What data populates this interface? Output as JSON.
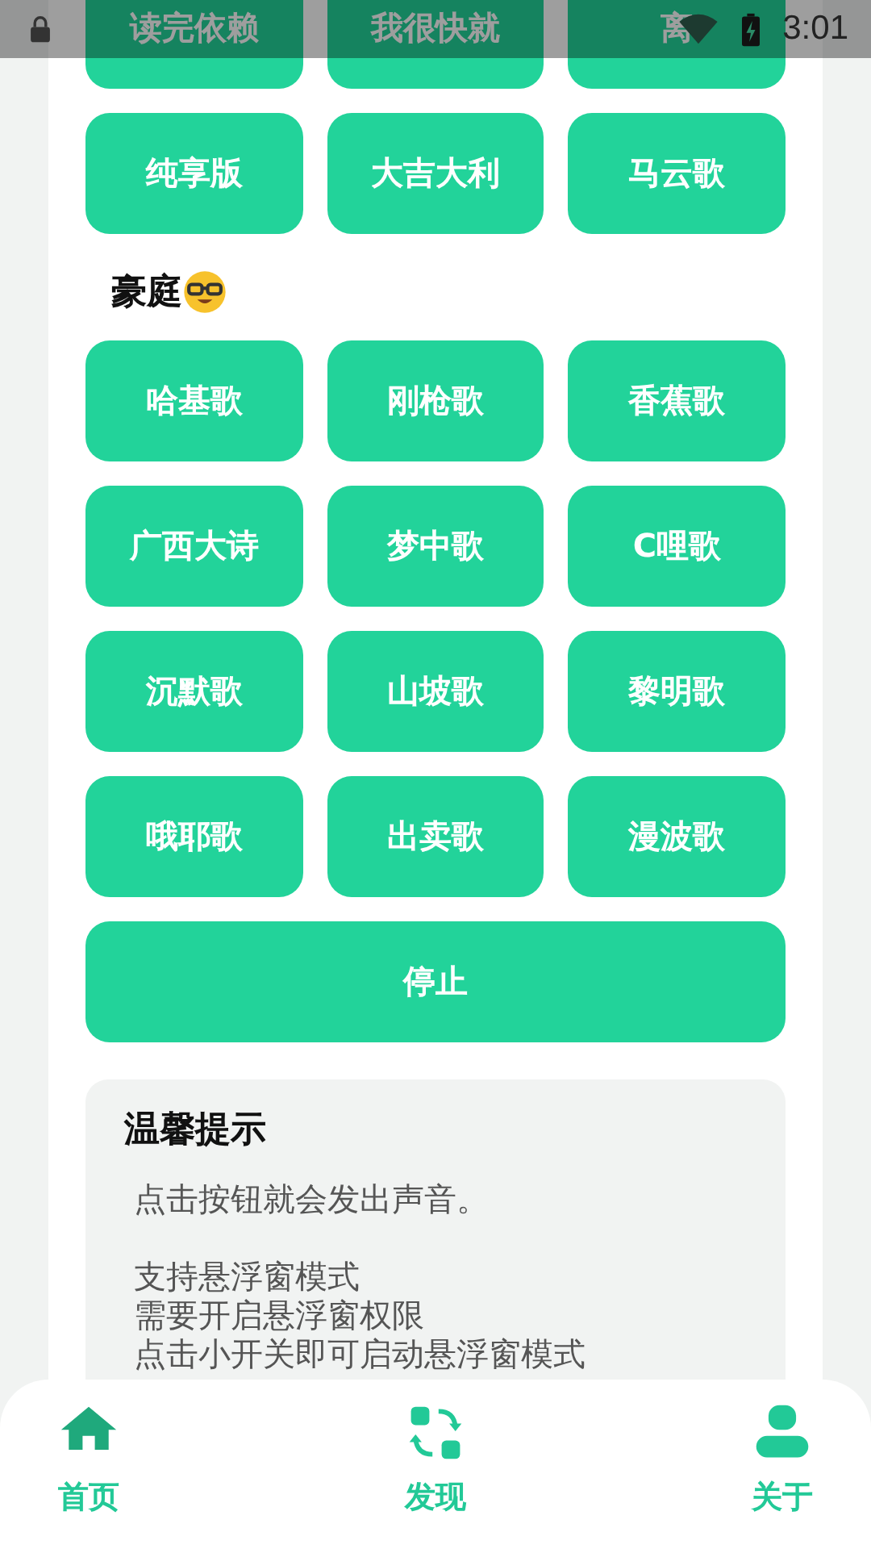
{
  "status_bar": {
    "time": "3:01"
  },
  "sections": [
    {
      "buttons": [
        "读完依赖",
        "我很快就",
        "离",
        "纯享版",
        "大吉大利",
        "马云歌"
      ]
    },
    {
      "title": "豪庭",
      "buttons": [
        "哈基歌",
        "刚枪歌",
        "香蕉歌",
        "广西大诗",
        "梦中歌",
        "C哩歌",
        "沉默歌",
        "山坡歌",
        "黎明歌",
        "哦耶歌",
        "出卖歌",
        "漫波歌"
      ],
      "wide_button": "停止"
    }
  ],
  "tips": {
    "title": "温馨提示",
    "paragraphs": [
      [
        "点击按钮就会发出声音。"
      ],
      [
        "支持悬浮窗模式",
        "需要开启悬浮窗权限",
        "点击小开关即可启动悬浮窗模式"
      ]
    ]
  },
  "nav": [
    {
      "label": "首页",
      "selected": true
    },
    {
      "label": "发现",
      "selected": false
    },
    {
      "label": "关于",
      "selected": false
    }
  ]
}
